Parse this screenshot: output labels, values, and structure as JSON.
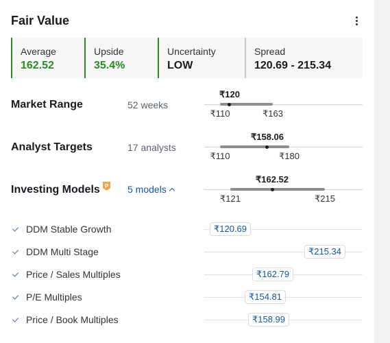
{
  "title": "Fair Value",
  "metrics": [
    {
      "label": "Average",
      "value": "162.52"
    },
    {
      "label": "Upside",
      "value": "35.4%"
    },
    {
      "label": "Uncertainty",
      "value": "LOW"
    },
    {
      "label": "Spread",
      "value": "120.69 - 215.34"
    }
  ],
  "market_range": {
    "label": "Market Range",
    "sub": "52 weeks",
    "current": "₹120",
    "low": "₹110",
    "high": "₹163"
  },
  "analyst_targets": {
    "label": "Analyst Targets",
    "sub": "17 analysts",
    "current": "₹158.06",
    "low": "₹110",
    "high": "₹180"
  },
  "investing_models": {
    "label": "Investing Models",
    "sub": "5 models",
    "current": "₹162.52",
    "low": "₹121",
    "high": "₹215"
  },
  "models": [
    {
      "name": "DDM Stable Growth",
      "value": "₹120.69"
    },
    {
      "name": "DDM Multi Stage",
      "value": "₹215.34"
    },
    {
      "name": "Price / Sales Multiples",
      "value": "₹162.79"
    },
    {
      "name": "P/E Multiples",
      "value": "₹154.81"
    },
    {
      "name": "Price / Book Multiples",
      "value": "₹158.99"
    }
  ],
  "icons": {
    "menu": "kebab-menu-icon",
    "pro": "pro-badge-icon",
    "chevron": "chevron-up-icon",
    "check": "check-icon"
  },
  "colors": {
    "positive": "#2a8a27",
    "link": "#1256a0",
    "border_neutral": "#c9c9c9"
  }
}
